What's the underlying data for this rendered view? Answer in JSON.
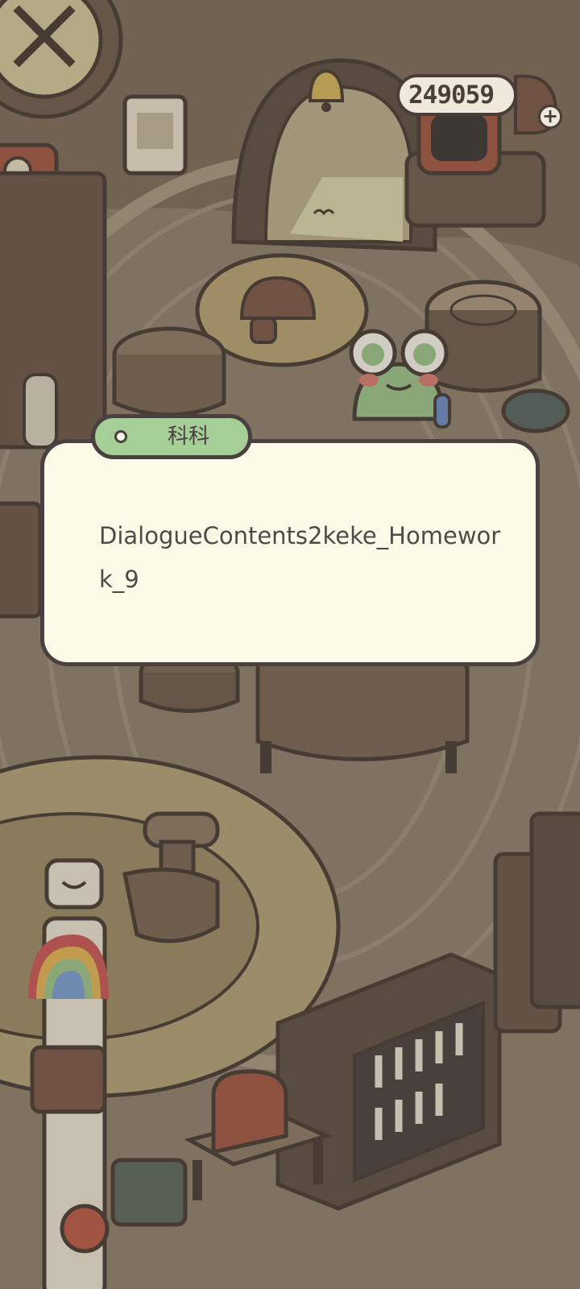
{
  "hud": {
    "coins": "249059",
    "add_symbol": "+"
  },
  "dialogue": {
    "speaker": "科科",
    "text": "DialogueContents2keke_Homework_9"
  },
  "scene": {
    "description_icons": [
      "clock-icon",
      "phone-icon",
      "bell-icon",
      "tv-icon",
      "frog-character",
      "bookshelf-icon",
      "chair-icon",
      "bag-icon",
      "apple-icon",
      "rainbow-icon"
    ]
  },
  "colors": {
    "dialogue_bg": "#fdfbe8",
    "speaker_tag": "#a6cf98",
    "outline": "#4a4040",
    "floor": "#8a7a68"
  }
}
